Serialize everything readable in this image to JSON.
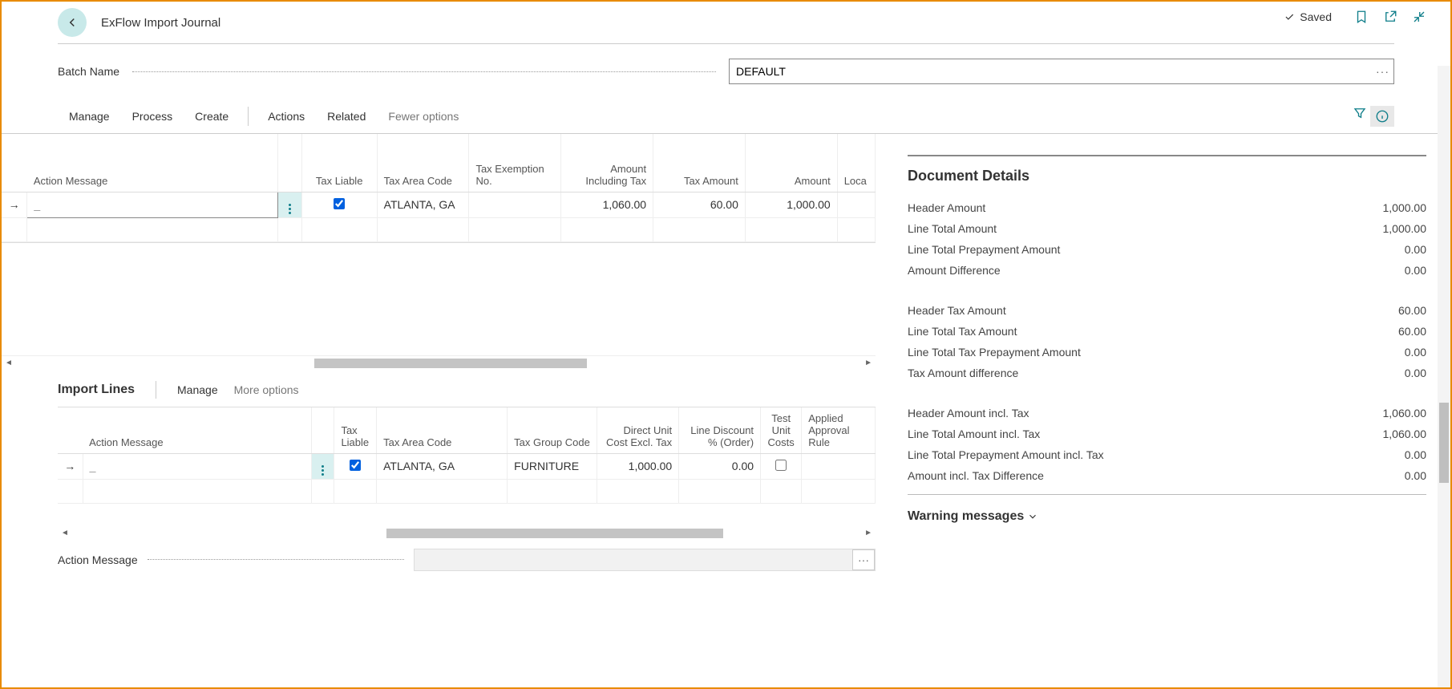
{
  "header": {
    "title": "ExFlow Import Journal",
    "saved_label": "Saved"
  },
  "batch": {
    "label": "Batch Name",
    "value": "DEFAULT"
  },
  "menu": {
    "manage": "Manage",
    "process": "Process",
    "create": "Create",
    "actions": "Actions",
    "related": "Related",
    "fewer": "Fewer options"
  },
  "main_grid": {
    "columns": {
      "action_message": "Action Message",
      "tax_liable": "Tax Liable",
      "tax_area_code": "Tax Area Code",
      "tax_exemption_no": "Tax Exemption No.",
      "amount_incl_tax": "Amount Including Tax",
      "tax_amount": "Tax Amount",
      "amount": "Amount",
      "loca": "Loca"
    },
    "rows": [
      {
        "action_message": "_",
        "tax_liable": true,
        "tax_area_code": "ATLANTA, GA",
        "tax_exemption_no": "",
        "amount_incl_tax": "1,060.00",
        "tax_amount": "60.00",
        "amount": "1,000.00",
        "loca": ""
      }
    ]
  },
  "import_lines": {
    "title": "Import Lines",
    "manage": "Manage",
    "more": "More options",
    "columns": {
      "action_message": "Action Message",
      "tax_liable": "Tax Liable",
      "tax_area_code": "Tax Area Code",
      "tax_group_code": "Tax Group Code",
      "direct_unit_cost": "Direct Unit Cost Excl. Tax",
      "line_discount": "Line Discount % (Order)",
      "test_unit_costs": "Test Unit Costs",
      "applied_rule": "Applied Approval Rule"
    },
    "rows": [
      {
        "action_message": "_",
        "tax_liable": true,
        "tax_area_code": "ATLANTA, GA",
        "tax_group_code": "FURNITURE",
        "direct_unit_cost": "1,000.00",
        "line_discount": "0.00",
        "test_unit_costs": false,
        "applied_rule": ""
      }
    ],
    "action_message_label": "Action Message"
  },
  "details": {
    "title": "Document Details",
    "rows1": [
      {
        "label": "Header Amount",
        "value": "1,000.00"
      },
      {
        "label": "Line Total Amount",
        "value": "1,000.00"
      },
      {
        "label": "Line Total Prepayment Amount",
        "value": "0.00"
      },
      {
        "label": "Amount Difference",
        "value": "0.00"
      }
    ],
    "rows2": [
      {
        "label": "Header Tax Amount",
        "value": "60.00"
      },
      {
        "label": "Line Total Tax Amount",
        "value": "60.00"
      },
      {
        "label": "Line Total Tax Prepayment Amount",
        "value": "0.00"
      },
      {
        "label": "Tax Amount difference",
        "value": "0.00"
      }
    ],
    "rows3": [
      {
        "label": "Header Amount incl. Tax",
        "value": "1,060.00"
      },
      {
        "label": "Line Total Amount incl. Tax",
        "value": "1,060.00"
      },
      {
        "label": "Line Total Prepayment Amount incl. Tax",
        "value": "0.00"
      },
      {
        "label": "Amount incl. Tax Difference",
        "value": "0.00"
      }
    ]
  },
  "warning": {
    "title": "Warning messages"
  }
}
